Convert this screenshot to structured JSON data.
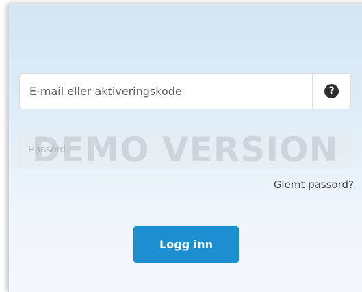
{
  "login": {
    "email_placeholder": "E-mail eller aktiveringskode",
    "help_icon_glyph": "?",
    "password_placeholder": "Passord",
    "watermark": "DEMO VERSION",
    "forgot_password": "Glemt passord?",
    "submit_label": "Logg inn"
  },
  "colors": {
    "accent": "#1b8fd0",
    "panel_top": "#d3e6f4",
    "panel_bottom": "#f4f8fc"
  },
  "icons": {
    "help": "question-circle-icon"
  }
}
